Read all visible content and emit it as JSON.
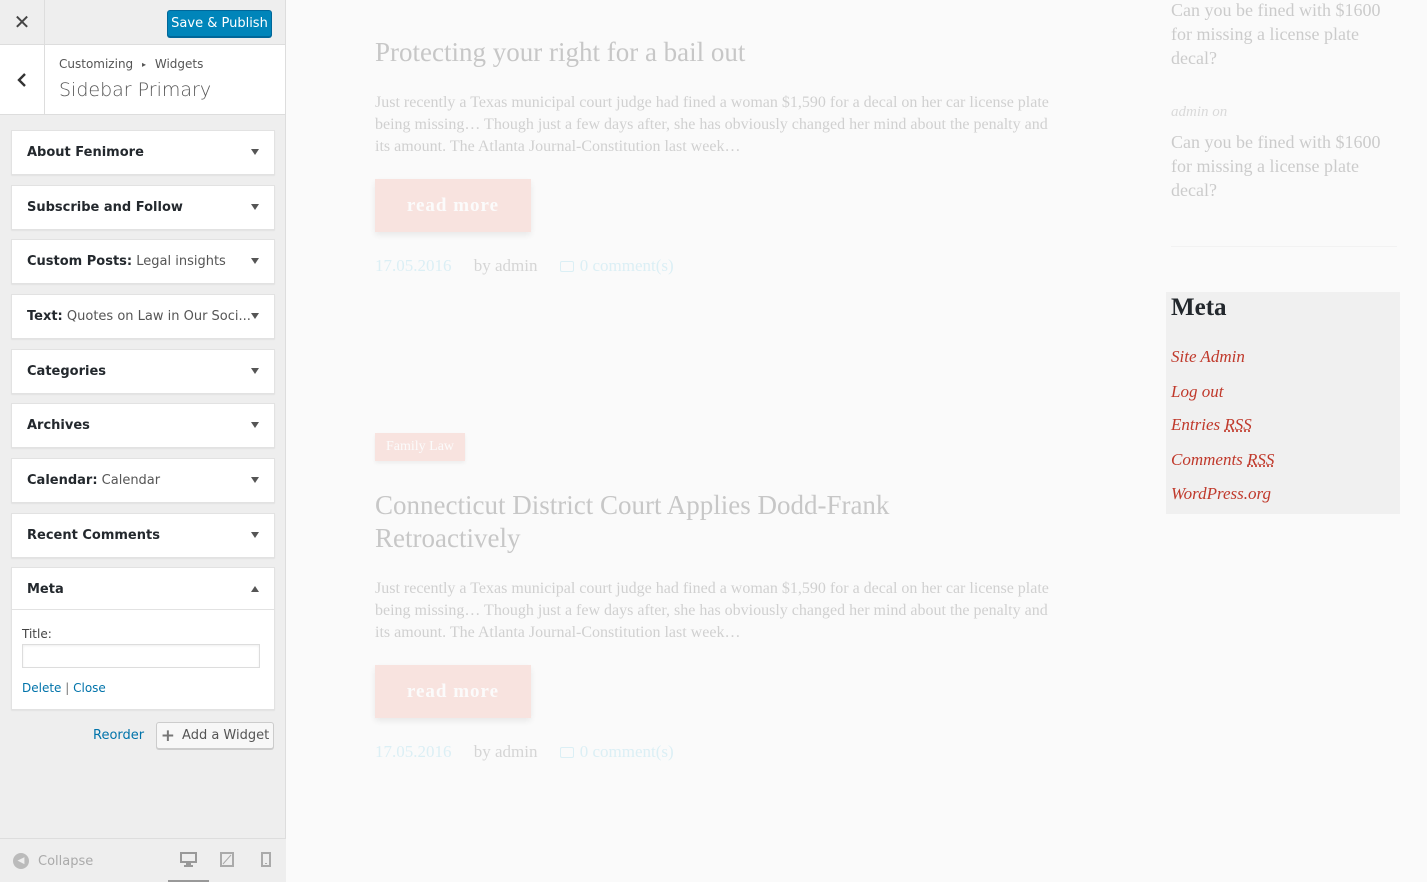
{
  "topbar": {
    "close_symbol": "✕",
    "save_label": "Save & Publish",
    "save_color": "#0085ba"
  },
  "section": {
    "back_symbol": "‹",
    "breadcrumb_root": "Customizing",
    "breadcrumb_separator": "▸",
    "breadcrumb_current": "Widgets",
    "title": "Sidebar Primary"
  },
  "widgets": [
    {
      "title": "About Fenimore",
      "subtitle": ""
    },
    {
      "title": "Subscribe and Follow",
      "subtitle": ""
    },
    {
      "title": "Custom Posts:",
      "subtitle": " Legal insights"
    },
    {
      "title": "Text:",
      "subtitle": " Quotes on Law in Our Soci..."
    },
    {
      "title": "Categories",
      "subtitle": ""
    },
    {
      "title": "Archives",
      "subtitle": ""
    },
    {
      "title": "Calendar:",
      "subtitle": " Calendar"
    },
    {
      "title": "Recent Comments",
      "subtitle": ""
    },
    {
      "title": "Meta",
      "subtitle": "",
      "expanded": true
    }
  ],
  "meta_widget_form": {
    "title_label": "Title:",
    "title_value": "",
    "delete_label": "Delete",
    "separator": " | ",
    "close_label": "Close"
  },
  "actions": {
    "reorder_label": "Reorder",
    "add_widget_label": "Add a Widget",
    "add_icon": "+"
  },
  "footer": {
    "collapse_label": "Collapse",
    "collapse_icon": "◀",
    "devices": [
      "desktop-icon",
      "tablet-icon",
      "mobile-icon"
    ],
    "active_device": "desktop"
  },
  "preview": {
    "posts": [
      {
        "title": "Protecting your right for a bail out",
        "excerpt": "Just recently a Texas municipal court judge had fined a woman $1,590 for a decal on her car license plate being missing… Though just a few days after, she has obviously changed her mind about the penalty and its amount. The Atlanta Journal-Constitution last week…",
        "read_more": "read more",
        "date": "17.05.2016",
        "author": "by admin",
        "comments": "0 comment(s)"
      },
      {
        "tag": "Family Law",
        "title": "Connecticut District Court Applies Dodd-Frank Retroactively",
        "excerpt": "Just recently a Texas municipal court judge had fined a woman $1,590 for a decal on her car license plate being missing… Though just a few days after, she has obviously changed her mind about the penalty and its amount. The Atlanta Journal-Constitution last week…",
        "read_more": "read more",
        "date": "17.05.2016",
        "author": "by admin",
        "comments": "0 comment(s)"
      }
    ],
    "recent_comments": {
      "first_link": "Can you be fined with $1600 for missing a license plate decal?",
      "author_line": "admin on",
      "second_link": "Can you be fined with $1600 for missing a license plate decal?"
    },
    "meta_box": {
      "heading": "Meta",
      "site_admin": "Site Admin",
      "log_out": "Log out",
      "entries": "Entries ",
      "entries_abbr": "RSS",
      "comments": "Comments ",
      "comments_abbr": "RSS",
      "wordpress": "WordPress.org",
      "link_color": "#c0392b"
    },
    "accent_colors": {
      "button": "#f5a89b",
      "date": "#8dd3e8"
    }
  }
}
